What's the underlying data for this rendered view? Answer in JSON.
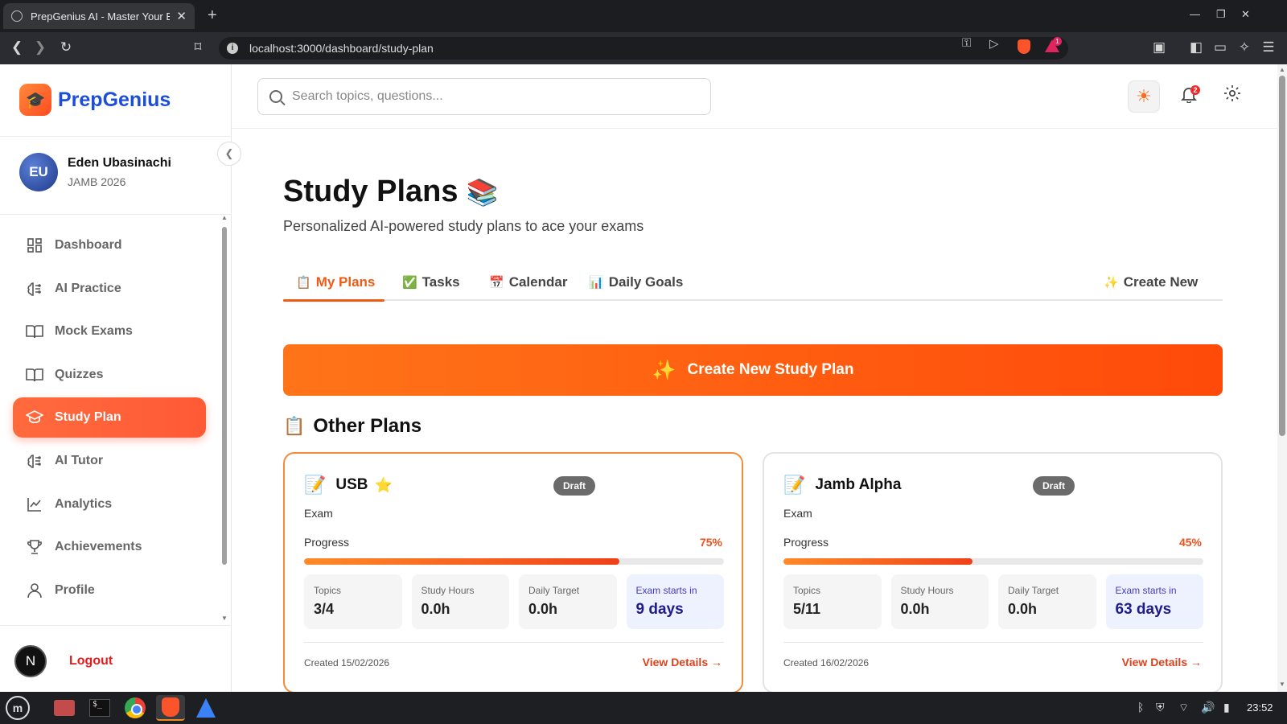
{
  "browser": {
    "tab_title": "PrepGenius AI - Master Your E",
    "tab_close": "✕",
    "new_tab": "+",
    "url": "localhost:3000/dashboard/study-plan",
    "rewards_count": "1"
  },
  "sidebar": {
    "brand": "PrepGenius",
    "user": {
      "initials": "EU",
      "name": "Eden Ubasinachi",
      "exam": "JAMB 2026"
    },
    "items": [
      {
        "label": "Dashboard",
        "icon": "grid-icon",
        "active": false
      },
      {
        "label": "AI Practice",
        "icon": "brain-icon",
        "active": false
      },
      {
        "label": "Mock Exams",
        "icon": "book-icon",
        "active": false
      },
      {
        "label": "Quizzes",
        "icon": "book-icon",
        "active": false
      },
      {
        "label": "Study Plan",
        "icon": "graduation-cap-icon",
        "active": true
      },
      {
        "label": "AI Tutor",
        "icon": "brain-icon",
        "active": false
      },
      {
        "label": "Analytics",
        "icon": "chart-line-icon",
        "active": false
      },
      {
        "label": "Achievements",
        "icon": "trophy-icon",
        "active": false
      },
      {
        "label": "Profile",
        "icon": "user-icon",
        "active": false
      }
    ],
    "logout_initial": "N",
    "logout": "Logout"
  },
  "header": {
    "search_placeholder": "Search topics, questions...",
    "notifications_count": "2"
  },
  "page": {
    "title": "Study Plans",
    "title_emoji": "📚",
    "subtitle": "Personalized AI-powered study plans to ace your exams",
    "tabs": [
      {
        "emoji": "📋",
        "label": "My Plans",
        "active": true
      },
      {
        "emoji": "✅",
        "label": "Tasks",
        "active": false
      },
      {
        "emoji": "📅",
        "label": "Calendar",
        "active": false
      },
      {
        "emoji": "📊",
        "label": "Daily Goals",
        "active": false
      }
    ],
    "create_new_tab": {
      "emoji": "✨",
      "label": "Create New"
    },
    "create_banner": {
      "emoji": "✨",
      "label": "Create New Study Plan"
    },
    "section_title": {
      "emoji": "📋",
      "label": "Other Plans"
    }
  },
  "plans": [
    {
      "emoji": "📝",
      "name": "USB",
      "starred": true,
      "star": "⭐",
      "status": "Draft",
      "type": "Exam",
      "progress_label": "Progress",
      "progress_text": "75%",
      "progress": 0.75,
      "stats": [
        {
          "label": "Topics",
          "value": "3/4"
        },
        {
          "label": "Study Hours",
          "value": "0.0h"
        },
        {
          "label": "Daily Target",
          "value": "0.0h"
        },
        {
          "label": "Exam starts in",
          "value": "9 days"
        }
      ],
      "created": "Created 15/02/2026",
      "view": "View Details →"
    },
    {
      "emoji": "📝",
      "name": "Jamb Alpha",
      "starred": false,
      "star": "",
      "status": "Draft",
      "type": "Exam",
      "progress_label": "Progress",
      "progress_text": "45%",
      "progress": 0.45,
      "stats": [
        {
          "label": "Topics",
          "value": "5/11"
        },
        {
          "label": "Study Hours",
          "value": "0.0h"
        },
        {
          "label": "Daily Target",
          "value": "0.0h"
        },
        {
          "label": "Exam starts in",
          "value": "63 days"
        }
      ],
      "created": "Created 16/02/2026",
      "view": "View Details →"
    }
  ],
  "taskbar": {
    "time": "23:52"
  },
  "colors": {
    "accent": "#f05a14",
    "brand_blue": "#1d4ed8",
    "danger": "#e11d1d",
    "exam_bg": "#eef2ff"
  }
}
